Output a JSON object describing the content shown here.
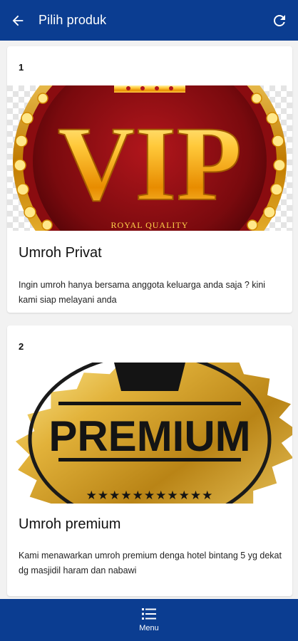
{
  "header": {
    "title": "Pilih produk",
    "back_icon": "arrow-left-icon",
    "refresh_icon": "refresh-icon"
  },
  "products": [
    {
      "number": "1",
      "name": "Umroh Privat",
      "description": "Ingin umroh hanya bersama anggota keluarga anda saja ? kini kami siap melayani anda",
      "image": {
        "badge_text": "VIP",
        "badge_subtext": "ROYAL QUALITY"
      }
    },
    {
      "number": "2",
      "name": "Umroh premium",
      "description": "Kami menawarkan umroh premium denga hotel bintang 5 yg dekat dg masjidil haram dan nabawi",
      "image": {
        "badge_text": "PREMIUM",
        "stars": "★★★★★★★★★★★"
      }
    }
  ],
  "bottom_nav": {
    "menu_label": "Menu",
    "menu_icon": "list-icon"
  },
  "colors": {
    "primary": "#0b3d91",
    "background": "#f2f2f2",
    "card": "#ffffff"
  }
}
